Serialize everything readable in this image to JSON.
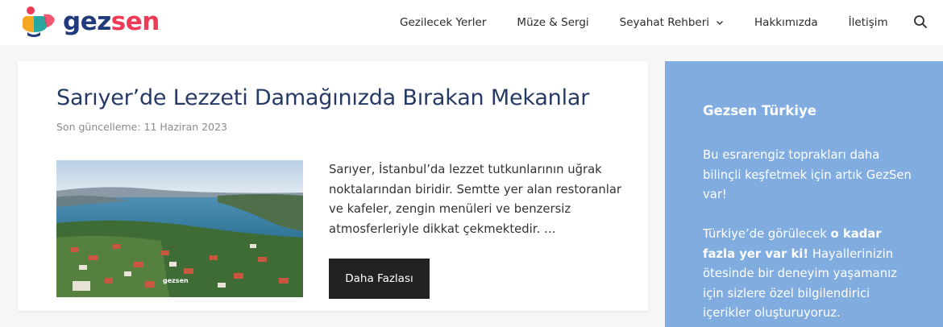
{
  "brand": {
    "part1": "gez",
    "part2": "sen",
    "color_primary": "#213a7a",
    "color_accent": "#ee3a57"
  },
  "nav": {
    "items": [
      {
        "label": "Gezilecek Yerler"
      },
      {
        "label": "Müze & Sergi"
      },
      {
        "label": "Seyahat Rehberi",
        "has_dropdown": true
      },
      {
        "label": "Hakkımızda"
      },
      {
        "label": "İletişim"
      }
    ],
    "search_icon": "search-icon"
  },
  "post": {
    "title": "Sarıyer’de Lezzeti Damağınızda Bırakan Mekanlar",
    "date": "Son güncelleme: 11 Haziran 2023",
    "excerpt": "Sarıyer, İstanbul’da lezzet tutkunlarının uğrak noktalarından biridir. Semtte yer alan restoranlar ve kafeler, zengin menüleri ve benzersiz atmosferleriyle dikkat çekmektedir. …",
    "button_label": "Daha Fazlası",
    "image_watermark": "gezsen"
  },
  "sidebar": {
    "title": "Gezsen Türkiye",
    "p1": "Bu esrarengiz toprakları daha bilinçli keşfetmek için artık GezSen var!",
    "p2_before": "Türkiye’de görülecek ",
    "p2_bold": "o kadar fazla yer var ki!",
    "p2_after": " Hayallerinizin ötesinde bir deneyim yaşamanız için sizlere özel bilgilendirici içerikler oluşturuyoruz.",
    "background": "#81ace0"
  }
}
